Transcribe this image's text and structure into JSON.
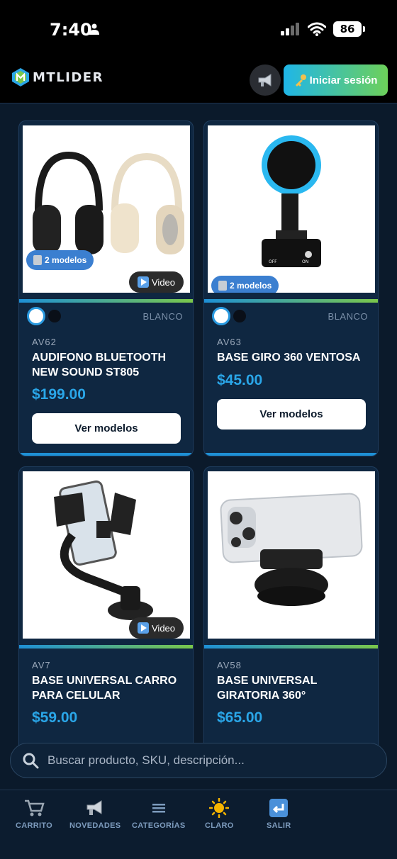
{
  "status": {
    "time": "7:40",
    "battery": "86"
  },
  "header": {
    "brand": "MTLIDER",
    "login_label": "Iniciar sesión"
  },
  "products": [
    {
      "sku": "AV62",
      "name": "AUDIFONO BLUETOOTH NEW SOUND ST805",
      "price": "$199.00",
      "models_badge": "2 modelos",
      "video_label": "Video",
      "color_label": "BLANCO",
      "button": "Ver modelos"
    },
    {
      "sku": "AV63",
      "name": "BASE GIRO 360 VENTOSA",
      "price": "$45.00",
      "models_badge": "2 modelos",
      "color_label": "BLANCO",
      "button": "Ver modelos",
      "img_text_off": "OFF",
      "img_text_on": "ON"
    },
    {
      "sku": "AV7",
      "name": "BASE UNIVERSAL CARRO PARA CELULAR",
      "price": "$59.00",
      "video_label": "Video"
    },
    {
      "sku": "AV58",
      "name": "BASE UNIVERSAL GIRATORIA 360°",
      "price": "$65.00"
    }
  ],
  "search": {
    "placeholder": "Buscar producto, SKU, descripción..."
  },
  "tabs": [
    {
      "label": "CARRITO",
      "icon": "cart-icon"
    },
    {
      "label": "NOVEDADES",
      "icon": "megaphone-icon"
    },
    {
      "label": "CATEGORÍAS",
      "icon": "menu-icon"
    },
    {
      "label": "CLARO",
      "icon": "sun-icon"
    },
    {
      "label": "SALIR",
      "icon": "exit-icon"
    }
  ]
}
